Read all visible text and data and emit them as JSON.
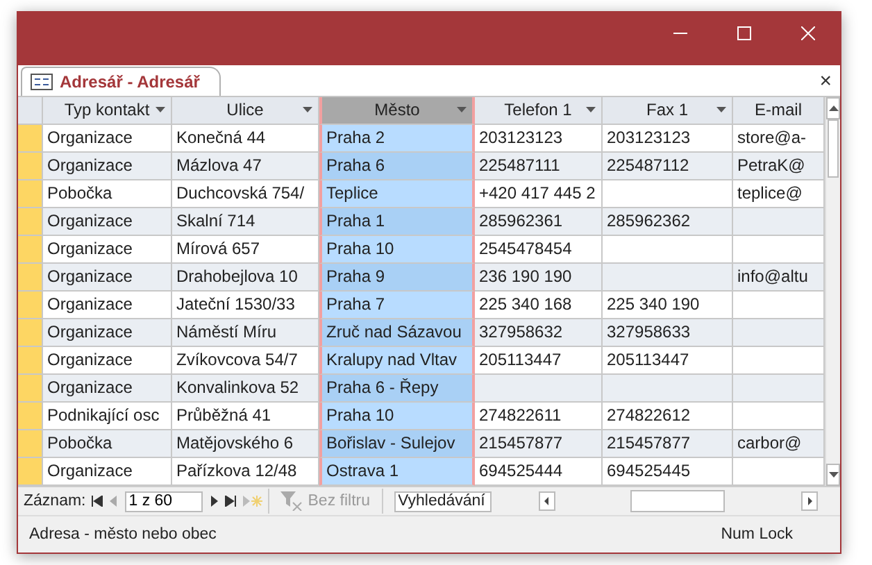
{
  "window": {
    "title_buttons": [
      {
        "kind": "minimize"
      },
      {
        "kind": "maximize"
      },
      {
        "kind": "close"
      }
    ]
  },
  "document_tab": {
    "title": "Adresář - Adresář",
    "close": "×"
  },
  "table": {
    "columns": [
      {
        "label": "Typ kontakt",
        "selected": false,
        "dropdown": true
      },
      {
        "label": "Ulice",
        "selected": false,
        "dropdown": true
      },
      {
        "label": "Město",
        "selected": true,
        "dropdown": true
      },
      {
        "label": "Telefon 1",
        "selected": false,
        "dropdown": true
      },
      {
        "label": "Fax 1",
        "selected": false,
        "dropdown": true
      },
      {
        "label": "E-mail",
        "selected": false,
        "dropdown": false
      }
    ],
    "rows": [
      [
        "Organizace",
        "Konečná 44",
        "Praha 2",
        "203123123",
        "203123123",
        "store@a-"
      ],
      [
        "Organizace",
        "Mázlova 47",
        "Praha 6",
        "225487111",
        "225487112",
        "PetraK@"
      ],
      [
        "Pobočka",
        "Duchcovská 754/",
        "Teplice",
        "+420 417 445 2",
        "",
        "teplice@"
      ],
      [
        "Organizace",
        "Skalní 714",
        "Praha 1",
        "285962361",
        "285962362",
        ""
      ],
      [
        "Organizace",
        "Mírová 657",
        "Praha 10",
        "2545478454",
        "",
        ""
      ],
      [
        "Organizace",
        "Drahobejlova 10",
        "Praha 9",
        "236 190 190",
        "",
        "info@altu"
      ],
      [
        "Organizace",
        "Jateční 1530/33",
        "Praha 7",
        "225 340 168",
        "225 340 190",
        ""
      ],
      [
        "Organizace",
        "Náměstí Míru",
        "Zruč nad Sázavou",
        "327958632",
        "327958633",
        ""
      ],
      [
        "Organizace",
        "Zvíkovcova 54/7",
        "Kralupy nad Vltav",
        "205113447",
        "205113447",
        ""
      ],
      [
        "Organizace",
        "Konvalinkova 52",
        "Praha 6 - Řepy",
        "",
        "",
        ""
      ],
      [
        "Podnikající osc",
        "Průběžná 41",
        "Praha 10",
        "274822611",
        "274822612",
        ""
      ],
      [
        "Pobočka",
        "Matějovského 6",
        "Bořislav - Sulejov",
        "215457877",
        "215457877",
        "carbor@"
      ],
      [
        "Organizace",
        "Pařízkova 12/48",
        "Ostrava 1",
        "694525444",
        "694525445",
        ""
      ]
    ]
  },
  "navigation": {
    "label": "Záznam:",
    "record": "1 z 60",
    "filter": "Bez filtru",
    "search": {
      "placeholder": "Vyhledávání"
    }
  },
  "status_bar": {
    "left": "Adresa - město nebo obec",
    "right": "Num Lock"
  }
}
